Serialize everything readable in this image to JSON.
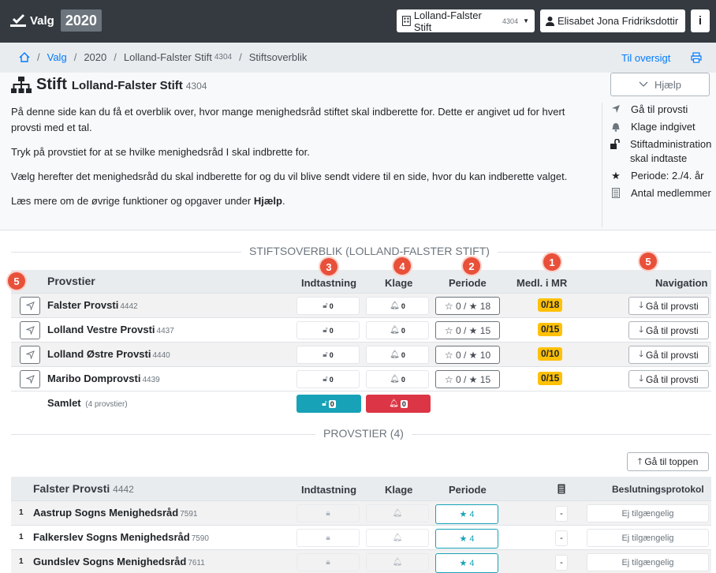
{
  "navbar": {
    "brand": "Valg",
    "year": "2020",
    "stift_label": "Lolland-Falster Stift",
    "stift_num": "4304",
    "user_name": "Elisabet Jona Fridriksdottir",
    "info_label": "i"
  },
  "breadcrumb": {
    "valg": "Valg",
    "year": "2020",
    "stift": "Lolland-Falster Stift",
    "stift_num": "4304",
    "current": "Stiftsoverblik",
    "overview_link": "Til oversigt"
  },
  "header": {
    "title": "Stift",
    "subtitle": "Lolland-Falster Stift",
    "subtitle_num": "4304",
    "help_label": "Hjælp",
    "desc1": "På denne side kan du få et overblik over, hvor mange menighedsråd stiftet skal indberette for. Dette er angivet ud for hvert provsti med et tal.",
    "desc2": "Tryk på provstiet for at se hvilke menighedsråd I skal indbrette for.",
    "desc3": "Vælg herefter det menighedsråd du skal indberette for og du vil blive sendt videre til en side, hvor du kan indberette valget.",
    "desc4_pre": "Læs mere om de øvrige funktioner og opgaver under ",
    "desc4_bold": "Hjælp",
    "desc4_post": "."
  },
  "legend": {
    "items": [
      {
        "icon": "navigate-icon",
        "label": "Gå til provsti"
      },
      {
        "icon": "bell-icon",
        "label": "Klage indgivet"
      },
      {
        "icon": "lock-open-icon",
        "label": "Stiftadministration skal indtaste"
      },
      {
        "icon": "star-icon",
        "label": "Periode: 2./4. år"
      },
      {
        "icon": "members-icon",
        "label": "Antal medlemmer"
      }
    ]
  },
  "overview": {
    "section_title": "STIFTSOVERBLIK (LOLLAND-FALSTER STIFT)",
    "headers": {
      "provstier": "Provstier",
      "indtastning": "Indtastning",
      "klage": "Klage",
      "periode": "Periode",
      "medl": "Medl. i MR",
      "navigation": "Navigation"
    },
    "badges": {
      "b_indtast": "3",
      "b_klage": "4",
      "b_periode": "2",
      "b_medl": "1",
      "b_nav": "5",
      "b_left": "5"
    },
    "rows": [
      {
        "name": "Falster Provsti",
        "num": "4442",
        "indtast": "0",
        "klage": "0",
        "p2": "0",
        "p4": "18",
        "mr": "0/18",
        "goto": "Gå til provsti"
      },
      {
        "name": "Lolland Vestre Provsti",
        "num": "4437",
        "indtast": "0",
        "klage": "0",
        "p2": "0",
        "p4": "15",
        "mr": "0/15",
        "goto": "Gå til provsti"
      },
      {
        "name": "Lolland Østre Provsti",
        "num": "4440",
        "indtast": "0",
        "klage": "0",
        "p2": "0",
        "p4": "10",
        "mr": "0/10",
        "goto": "Gå til provsti"
      },
      {
        "name": "Maribo Domprovsti",
        "num": "4439",
        "indtast": "0",
        "klage": "0",
        "p2": "0",
        "p4": "15",
        "mr": "0/15",
        "goto": "Gå til provsti"
      }
    ],
    "total": {
      "label": "Samlet",
      "sub": "(4 provstier)",
      "indtast": "0",
      "klage": "0"
    }
  },
  "provstier": {
    "section_title": "PROVSTIER (4)",
    "top_button": "Gå til toppen",
    "headers": {
      "name": "Falster Provsti",
      "num": "4442",
      "indtastning": "Indtastning",
      "klage": "Klage",
      "periode": "Periode",
      "protokol": "Beslutningsprotokol"
    },
    "rows": [
      {
        "idx": "1",
        "name": "Aastrup Sogns Menighedsråd",
        "num": "7591",
        "periode": "4",
        "members": "-",
        "protokol": "Ej tilgængelig"
      },
      {
        "idx": "1",
        "name": "Falkerslev Sogns Menighedsråd",
        "num": "7590",
        "periode": "4",
        "members": "-",
        "protokol": "Ej tilgængelig"
      },
      {
        "idx": "1",
        "name": "Gundslev Sogns Menighedsråd",
        "num": "7611",
        "periode": "4",
        "members": "-",
        "protokol": "Ej tilgængelig"
      }
    ]
  },
  "colors": {
    "navbar": "#343a40",
    "accent": "#007bff",
    "teal": "#17a2b8",
    "red": "#dc3545",
    "warning": "#ffc107",
    "badge": "#e8503a"
  }
}
